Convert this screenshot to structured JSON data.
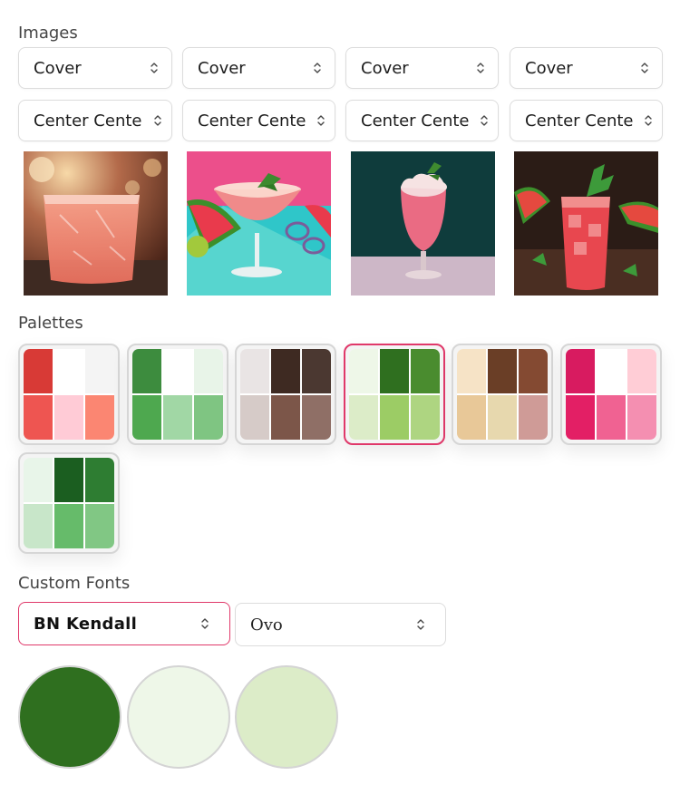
{
  "images_section": {
    "title": "Images",
    "fit_selects": [
      "Cover",
      "Cover",
      "Cover",
      "Cover"
    ],
    "position_selects": [
      "Center Cente",
      "Center Cente",
      "Center Cente",
      "Center Cente"
    ]
  },
  "palettes_section": {
    "title": "Palettes",
    "palettes": [
      {
        "colors": [
          "#d83a36",
          "#ffffff",
          "#f4f4f4",
          "#ee5551",
          "#ffcbd6",
          "#fb8672"
        ],
        "selected": false
      },
      {
        "colors": [
          "#3d8c3e",
          "#ffffff",
          "#e8f4e8",
          "#4ea84f",
          "#a1d7a5",
          "#7fc582"
        ],
        "selected": false
      },
      {
        "colors": [
          "#e9e4e4",
          "#3e2a22",
          "#4b3831",
          "#d6cbc8",
          "#7c5649",
          "#8f6f66"
        ],
        "selected": false
      },
      {
        "colors": [
          "#eef7e8",
          "#2f6f1f",
          "#4a8c2f",
          "#dcecc8",
          "#9ccc65",
          "#aed581"
        ],
        "selected": true
      },
      {
        "colors": [
          "#f6e3c6",
          "#6a3e26",
          "#844a32",
          "#e8c898",
          "#e7d8ae",
          "#cf9b97"
        ],
        "selected": false
      },
      {
        "colors": [
          "#d81b60",
          "#ffffff",
          "#ffcdd6",
          "#e31f65",
          "#f06292",
          "#f48fb1"
        ],
        "selected": false
      },
      {
        "colors": [
          "#e8f5e9",
          "#1b5e20",
          "#2e7d32",
          "#c8e6c9",
          "#66bb6a",
          "#81c784"
        ],
        "selected": false
      }
    ]
  },
  "fonts_section": {
    "title": "Custom Fonts",
    "heading_font": "BN Kendall",
    "body_font": "Ovo"
  },
  "swatches": [
    "#2f6f1f",
    "#eef7e8",
    "#dcecc8"
  ],
  "colors": {
    "accent": "#e0386a"
  }
}
